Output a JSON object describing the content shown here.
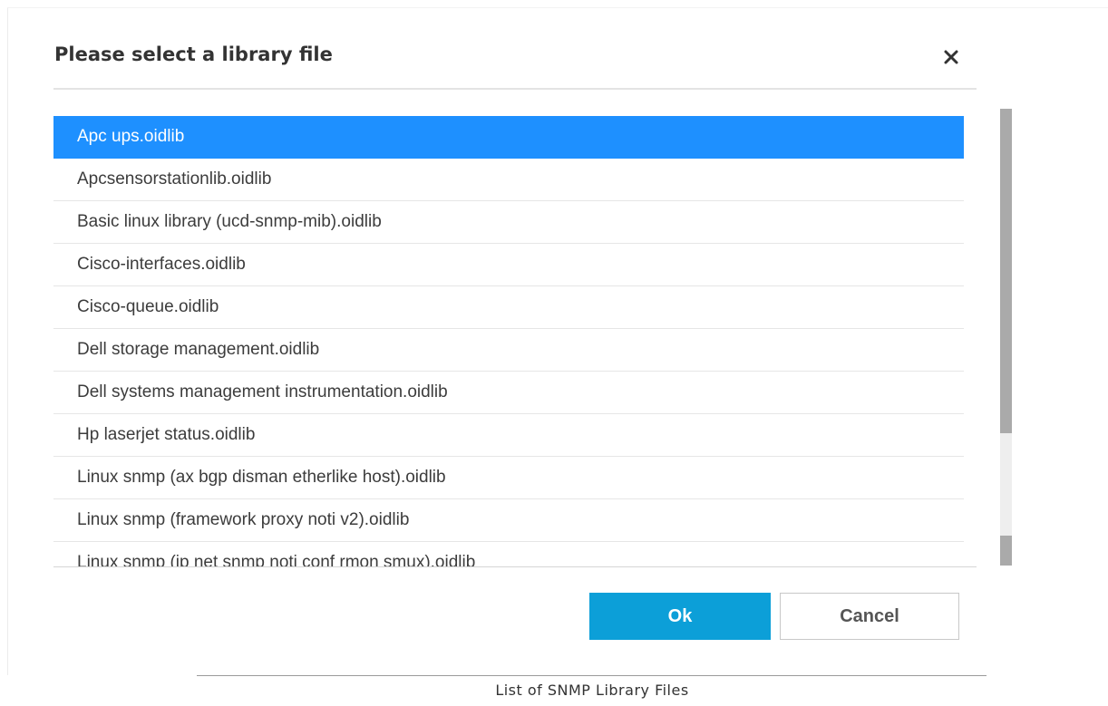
{
  "dialog": {
    "title": "Please select a library file",
    "close_icon": "close-icon"
  },
  "file_list": {
    "selected_index": 0,
    "items": [
      {
        "label": "Apc ups.oidlib"
      },
      {
        "label": "Apcsensorstationlib.oidlib"
      },
      {
        "label": "Basic linux library (ucd-snmp-mib).oidlib"
      },
      {
        "label": "Cisco-interfaces.oidlib"
      },
      {
        "label": "Cisco-queue.oidlib"
      },
      {
        "label": "Dell storage management.oidlib"
      },
      {
        "label": "Dell systems management instrumentation.oidlib"
      },
      {
        "label": "Hp laserjet status.oidlib"
      },
      {
        "label": "Linux snmp (ax bgp disman etherlike host).oidlib"
      },
      {
        "label": "Linux snmp (framework proxy noti v2).oidlib"
      },
      {
        "label": "Linux snmp (ip net snmp noti conf rmon smux).oidlib"
      }
    ]
  },
  "buttons": {
    "ok_label": "Ok",
    "cancel_label": "Cancel"
  },
  "caption": "List of SNMP Library Files",
  "colors": {
    "selection": "#1e90ff",
    "ok_button": "#0c9fd8"
  }
}
